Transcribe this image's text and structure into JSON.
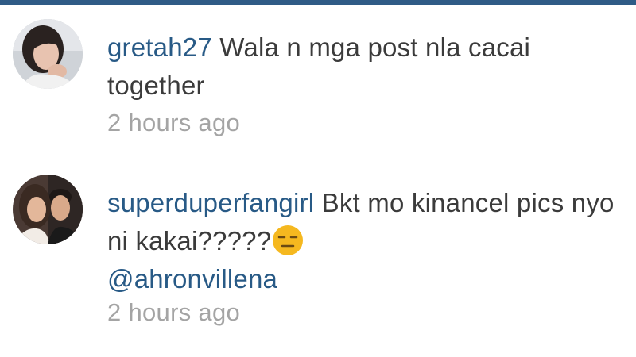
{
  "comments": [
    {
      "username": "gretah27",
      "text": "Wala n mga post nla cacai together",
      "timestamp": "2 hours ago",
      "avatar_icon": "profile-photo-woman-icon"
    },
    {
      "username": "superduperfangirl",
      "text": "Bkt mo kinancel pics nyo ni kakai?????",
      "emoji": "expressionless-face-emoji",
      "mention": "@ahronvillena",
      "timestamp": "2 hours ago",
      "avatar_icon": "profile-photo-couple-icon"
    }
  ],
  "colors": {
    "username": "#285a86",
    "comment_text": "#3b3b3b",
    "timestamp": "#a4a4a4",
    "top_bar": "#2f5b86",
    "emoji": "#f5b81f"
  }
}
